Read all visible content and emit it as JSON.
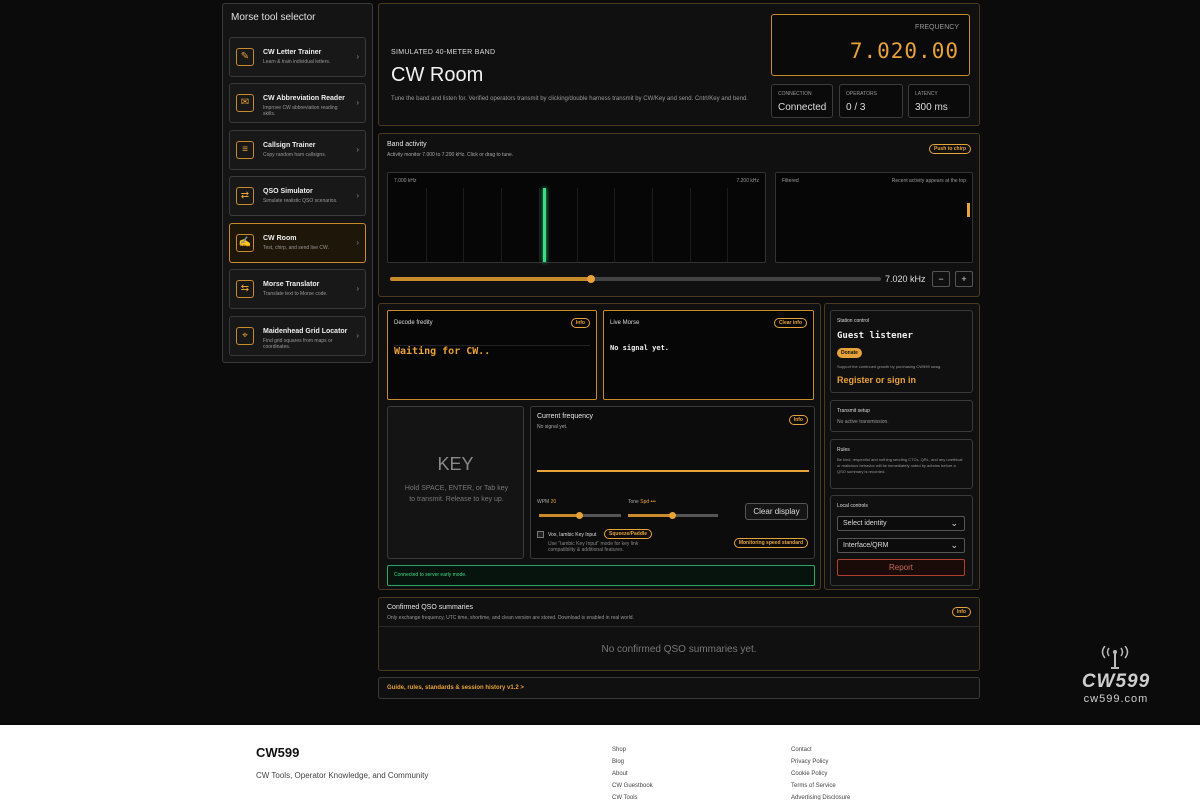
{
  "sidebar": {
    "title": "Morse tool selector",
    "items": [
      {
        "label": "CW Letter Trainer",
        "desc": "Learn & train individual letters."
      },
      {
        "label": "CW Abbreviation Reader",
        "desc": "Improve CW abbreviation reading skills."
      },
      {
        "label": "Callsign Trainer",
        "desc": "Copy random ham callsigns."
      },
      {
        "label": "QSO Simulator",
        "desc": "Simulate realistic QSO scenarios."
      },
      {
        "label": "CW Room",
        "desc": "Test, chirp, and send live CW."
      },
      {
        "label": "Morse Translator",
        "desc": "Translate text to Morse code."
      },
      {
        "label": "Maidenhead Grid Locator",
        "desc": "Find grid squares from maps or coordinates."
      }
    ]
  },
  "header": {
    "eyebrow": "SIMULATED 40-METER BAND",
    "title": "CW Room",
    "desc": "Tune the band and listen for. Verified operators transmit by clicking/double harness transmit by CW/Key and send. Cntrl/Key and bend.",
    "frequency_label": "FREQUENCY",
    "frequency_value": "7.020.00",
    "connection_label": "CONNECTION",
    "connection_value": "Connected",
    "operators_label": "OPERATORS",
    "operators_value": "0 / 3",
    "latency_label": "LATENCY",
    "latency_value": "300 ms"
  },
  "band": {
    "title": "Band activity",
    "desc": "Activity monitor 7.000 to 7.200 kHz. Click or drag to tune.",
    "push_label": "Push to chirp",
    "left_label": "7.000 kHz",
    "right_label": "7.200 kHz",
    "filtered_label": "Filtered",
    "recent_label": "Recent activity appears at the top",
    "tuner_value": "7.020 kHz",
    "tune_fraction": 0.1,
    "minus": "−",
    "plus": "+"
  },
  "decode": {
    "title": "Decode fredity",
    "info": "Info",
    "text": "Waiting for CW.."
  },
  "live": {
    "title": "Live Morse",
    "info": "Clear info",
    "text": "No signal yet."
  },
  "key": {
    "title": "KEY",
    "desc": "Hold SPACE, ENTER, or Tab key to transmit. Release to key up."
  },
  "current": {
    "title": "Current frequency",
    "info": "Info",
    "sub": "No signal yet.",
    "wpm_label": "WPM",
    "wpm_value": "20",
    "tone_label": "Tone",
    "tone_value": "Spd",
    "tone_dots": "•••",
    "wpm_fraction": 0.5,
    "tone_fraction": 0.5,
    "clear_label": "Clear display",
    "iambic_label": "Vox, Iambic Key Input",
    "iambic_pill": "Squeeze/Paddle",
    "iambic_desc": "Use \"Iambic Key Input\" mode for key link compatibility & additional features.",
    "monitor_pill": "Monitoring speed standard"
  },
  "status_text": "Connected to server early mode.",
  "station": {
    "title": "Station control",
    "name": "Guest listener",
    "donate": "Donate",
    "support": "Support the continued growth by purchasing CW599 swag.",
    "register": "Register or sign in"
  },
  "transmit": {
    "title": "Transmit setup",
    "desc": "No active transmission."
  },
  "rules": {
    "title": "Rules",
    "desc": "Be kind, respectful and nothing sending CTCs, QRL, and any unethical or malicious behavior will be immediately noted by admins before a QSO summary is recorded."
  },
  "local": {
    "title": "Local controls",
    "identity": "Select identity",
    "interface": "Interface/QRM",
    "report": "Report"
  },
  "qso": {
    "title": "Confirmed QSO summaries",
    "desc": "Only exchange frequency, UTC time, shortime, and clean version are stored. Download is enabled in real world.",
    "info": "Info",
    "empty": "No confirmed QSO summaries yet."
  },
  "guide": "Guide, rules, standards & session history v1.2 >",
  "logo": {
    "name": "CW599",
    "url": "cw599.com"
  },
  "footer": {
    "brand": "CW599",
    "tagline": "CW Tools, Operator Knowledge, and Community",
    "col1": [
      "Shop",
      "Blog",
      "About",
      "CW Guestbook",
      "CW Tools"
    ],
    "col2": [
      "Contact",
      "Privacy Policy",
      "Cookie Policy",
      "Terms of Service",
      "Advertising Disclosure"
    ]
  },
  "colors": {
    "accent": "#e8a23a",
    "signal": "#3ddc84",
    "bg": "#0b0b0b"
  }
}
